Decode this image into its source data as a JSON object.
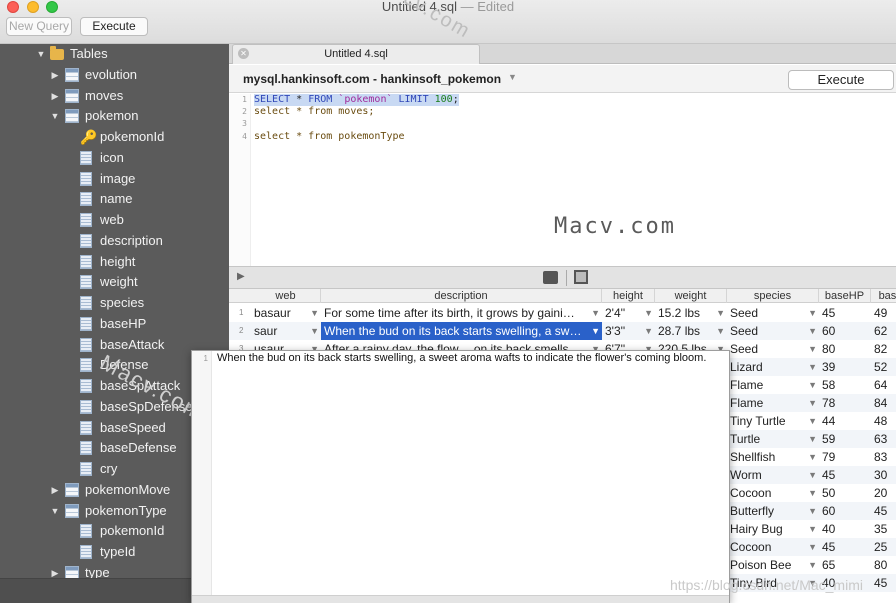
{
  "window": {
    "title": "Untitled 4.sql",
    "edited": "— Edited"
  },
  "toolbar": {
    "new_query": "New Query",
    "execute": "Execute"
  },
  "sidebar": {
    "items": [
      {
        "label": "Tables",
        "kind": "folder",
        "state": "expanded"
      },
      {
        "label": "evolution",
        "kind": "table",
        "state": "collapsed"
      },
      {
        "label": "moves",
        "kind": "table",
        "state": "collapsed"
      },
      {
        "label": "pokemon",
        "kind": "table",
        "state": "expanded"
      },
      {
        "label": "pokemonId",
        "kind": "key"
      },
      {
        "label": "icon",
        "kind": "column"
      },
      {
        "label": "image",
        "kind": "column"
      },
      {
        "label": "name",
        "kind": "column"
      },
      {
        "label": "web",
        "kind": "column"
      },
      {
        "label": "description",
        "kind": "column"
      },
      {
        "label": "height",
        "kind": "column"
      },
      {
        "label": "weight",
        "kind": "column"
      },
      {
        "label": "species",
        "kind": "column"
      },
      {
        "label": "baseHP",
        "kind": "column"
      },
      {
        "label": "baseAttack",
        "kind": "column"
      },
      {
        "label": "Defense",
        "kind": "column"
      },
      {
        "label": "baseSpAttack",
        "kind": "column"
      },
      {
        "label": "baseSpDefense",
        "kind": "column"
      },
      {
        "label": "baseSpeed",
        "kind": "column"
      },
      {
        "label": "baseDefense",
        "kind": "column"
      },
      {
        "label": "cry",
        "kind": "column"
      },
      {
        "label": "pokemonMove",
        "kind": "table",
        "state": "collapsed"
      },
      {
        "label": "pokemonType",
        "kind": "table",
        "state": "expanded"
      },
      {
        "label": "pokemonId",
        "kind": "column"
      },
      {
        "label": "typeId",
        "kind": "column"
      },
      {
        "label": "type",
        "kind": "table",
        "state": "collapsed"
      }
    ]
  },
  "editor": {
    "tab_label": "Untitled 4.sql",
    "connection": "mysql.hankinsoft.com - hankinsoft_pokemon",
    "execute_label": "Execute",
    "lines": [
      {
        "n": "1",
        "kw1": "SELECT",
        "mid1": " * ",
        "kw2": "FROM",
        "str": " `pokemon` ",
        "kw3": "LIMIT",
        "num": " 100",
        "tail": ";"
      },
      {
        "n": "2",
        "text": "select * from moves;"
      },
      {
        "n": "3",
        "text": ""
      },
      {
        "n": "4",
        "text": "select * from pokemonType"
      }
    ]
  },
  "watermarks": {
    "a": "Macv.com",
    "b": "cv.com",
    "c": "Macv.com",
    "footer": "https://blog.csdn.net/Mac_mimi"
  },
  "grid": {
    "columns": [
      "web",
      "description",
      "height",
      "weight",
      "species",
      "baseHP",
      "base"
    ],
    "rows": [
      {
        "n": "1",
        "web": "basaur",
        "description": "For some time after its birth, it grows by gaini…",
        "height": "2'4''",
        "weight": "15.2 lbs",
        "species": "Seed",
        "baseHP": "45",
        "base": "49"
      },
      {
        "n": "2",
        "web": "saur",
        "description": "When the bud on its back starts swelling, a sw…",
        "height": "3'3''",
        "weight": "28.7 lbs",
        "species": "Seed",
        "baseHP": "60",
        "base": "62"
      },
      {
        "n": "3",
        "web": "usaur",
        "description": "After a rainy day, the flow… on its back smells…",
        "height": "6'7''",
        "weight": "220.5 lbs",
        "species": "Seed",
        "baseHP": "80",
        "base": "82"
      },
      {
        "species": "Lizard",
        "baseHP": "39",
        "base": "52"
      },
      {
        "species": "Flame",
        "baseHP": "58",
        "base": "64"
      },
      {
        "species": "Flame",
        "baseHP": "78",
        "base": "84"
      },
      {
        "species": "Tiny Turtle",
        "baseHP": "44",
        "base": "48"
      },
      {
        "species": "Turtle",
        "baseHP": "59",
        "base": "63"
      },
      {
        "species": "Shellfish",
        "baseHP": "79",
        "base": "83"
      },
      {
        "species": "Worm",
        "baseHP": "45",
        "base": "30"
      },
      {
        "species": "Cocoon",
        "baseHP": "50",
        "base": "20"
      },
      {
        "species": "Butterfly",
        "baseHP": "60",
        "base": "45"
      },
      {
        "species": "Hairy Bug",
        "baseHP": "40",
        "base": "35"
      },
      {
        "species": "Cocoon",
        "baseHP": "45",
        "base": "25"
      },
      {
        "species": "Poison Bee",
        "baseHP": "65",
        "base": "80"
      },
      {
        "species": "Tiny Bird",
        "baseHP": "40",
        "base": "45"
      }
    ]
  },
  "popup": {
    "line": "1",
    "text": "When the bud on its back starts swelling, a sweet aroma wafts to indicate the flower's coming bloom."
  }
}
